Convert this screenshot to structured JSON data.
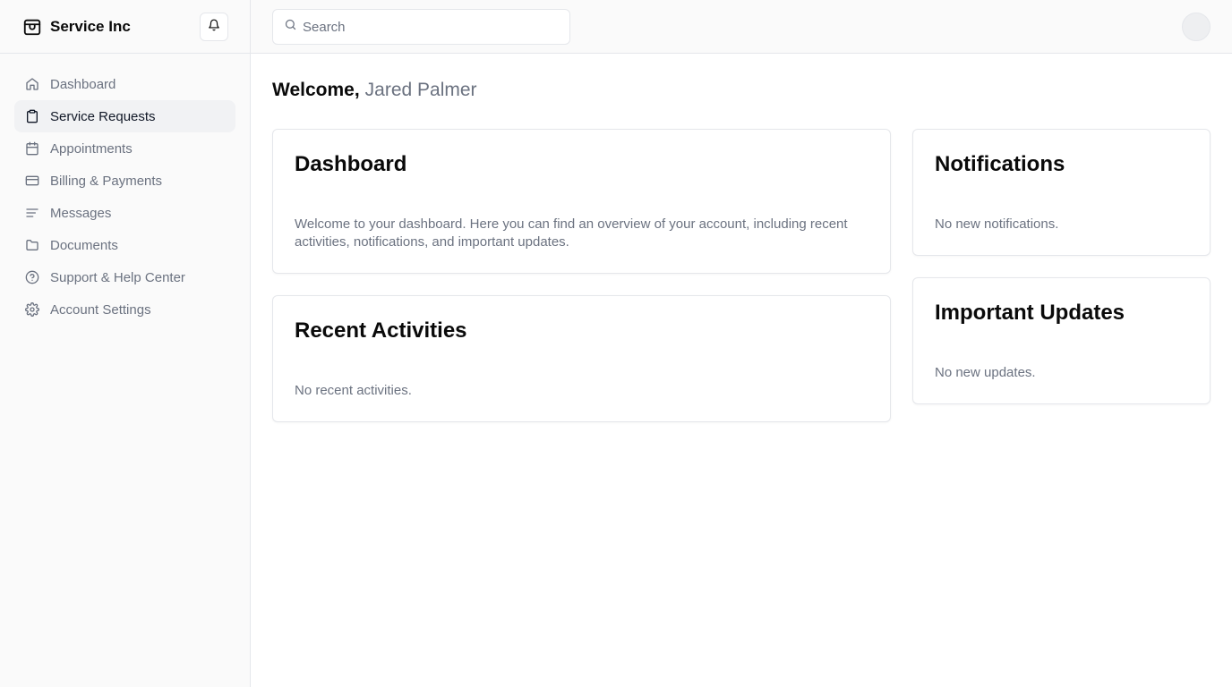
{
  "brand": {
    "name": "Service Inc"
  },
  "icons": {
    "brand": "store-icon",
    "bell": "bell-icon",
    "search": "search-icon"
  },
  "sidebar": {
    "items": [
      {
        "label": "Dashboard",
        "icon": "home-icon",
        "active": false
      },
      {
        "label": "Service Requests",
        "icon": "clipboard-icon",
        "active": true
      },
      {
        "label": "Appointments",
        "icon": "calendar-icon",
        "active": false
      },
      {
        "label": "Billing & Payments",
        "icon": "credit-card-icon",
        "active": false
      },
      {
        "label": "Messages",
        "icon": "text-lines-icon",
        "active": false
      },
      {
        "label": "Documents",
        "icon": "folder-icon",
        "active": false
      },
      {
        "label": "Support & Help Center",
        "icon": "help-circle-icon",
        "active": false
      },
      {
        "label": "Account Settings",
        "icon": "gear-icon",
        "active": false
      }
    ]
  },
  "search": {
    "placeholder": "Search",
    "value": ""
  },
  "welcome": {
    "label": "Welcome,",
    "name": "Jared Palmer"
  },
  "cards": {
    "dashboard": {
      "title": "Dashboard",
      "body": "Welcome to your dashboard. Here you can find an overview of your account, including recent activities, notifications, and important updates."
    },
    "recent": {
      "title": "Recent Activities",
      "body": "No recent activities."
    },
    "notifications": {
      "title": "Notifications",
      "body": "No new notifications."
    },
    "updates": {
      "title": "Important Updates",
      "body": "No new updates."
    }
  },
  "colors": {
    "muted_text": "#6b7280",
    "border": "#e5e7eb",
    "sidebar_bg": "#fafafa",
    "active_bg": "#f1f2f4"
  }
}
